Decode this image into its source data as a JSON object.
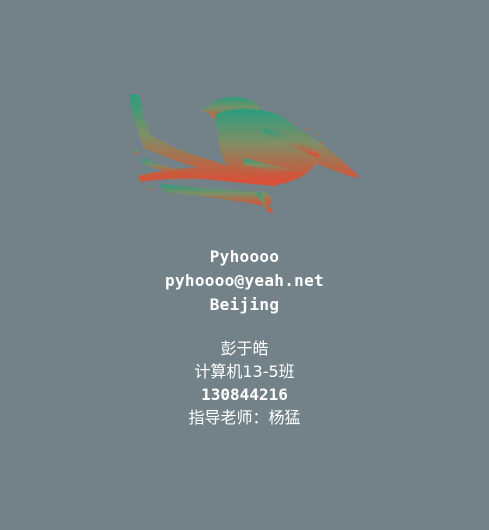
{
  "logo": {
    "icon": "bird-on-branch-icon",
    "gradient_top": "#2a9d7e",
    "gradient_bottom": "#e04a32"
  },
  "profile": {
    "name": "Pyhoooo",
    "email": "pyhoooo@yeah.net",
    "location": "Beijing"
  },
  "student": {
    "name": "彭于皓",
    "class": "计算机13-5班",
    "id": "130844216",
    "advisor": "指导老师：杨猛"
  },
  "colors": {
    "background": "#738288",
    "text": "#ffffff"
  }
}
